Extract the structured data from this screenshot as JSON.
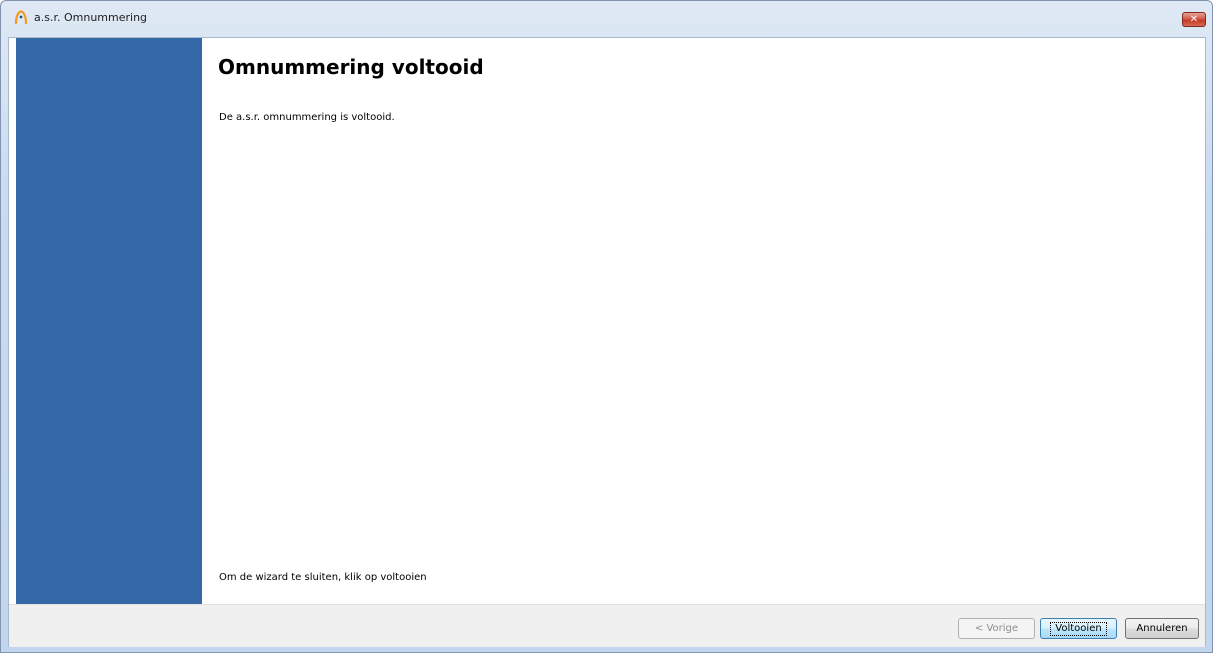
{
  "window": {
    "title": "a.s.r. Omnummering",
    "icon": "asr-logo-icon",
    "close_glyph": "✕"
  },
  "wizard": {
    "title": "Omnummering voltooid",
    "message": "De a.s.r. omnummering is voltooid.",
    "footer_note": "Om de wizard te sluiten, klik op voltooien",
    "side_panel_color": "#3568a6"
  },
  "buttons": {
    "previous": {
      "label": "< Vorige",
      "enabled": false
    },
    "finish": {
      "label": "Voltooien",
      "enabled": true,
      "default": true
    },
    "cancel": {
      "label": "Annuleren",
      "enabled": true
    }
  },
  "colors": {
    "accent": "#3568a6",
    "close_button": "#c23a26",
    "logo": "#f39a1b"
  }
}
